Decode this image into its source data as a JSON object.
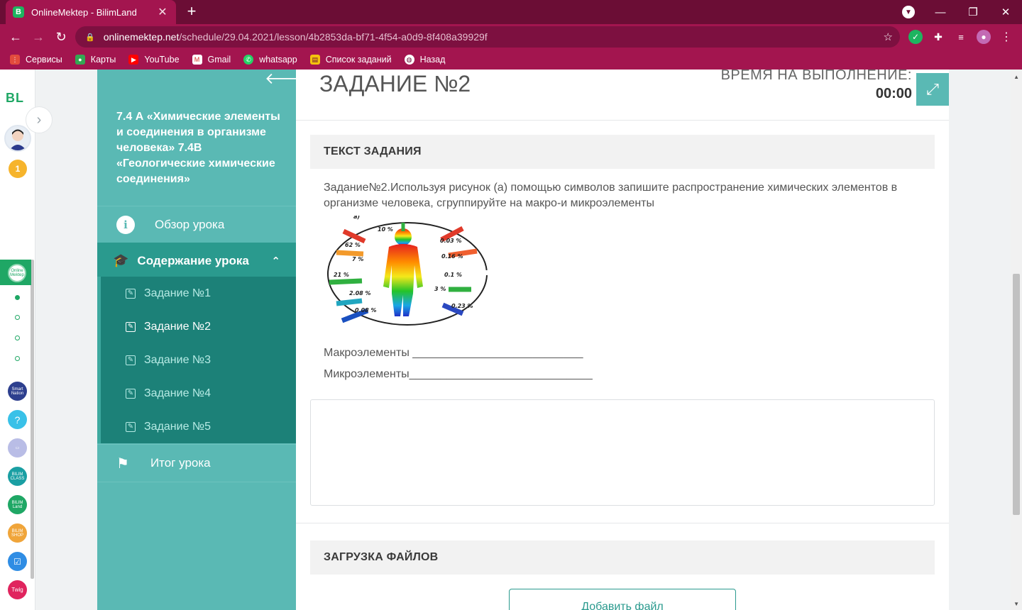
{
  "browser": {
    "tab_title": "OnlineMektep - BilimLand",
    "tab_favicon": "B",
    "url_host": "onlinemektep.net",
    "url_path": "/schedule/29.04.2021/lesson/4b2853da-bf71-4f54-a0d9-8f408a39929f",
    "bookmarks": [
      "Сервисы",
      "Карты",
      "YouTube",
      "Gmail",
      "whatsapp",
      "Список заданий",
      "Назад"
    ]
  },
  "iconbar": {
    "logo": "BL",
    "badge": "1",
    "online_label": "Online Mektep",
    "apps": [
      "Smart Nation",
      "?",
      "",
      "BILIM CLASS",
      "BILIM Land",
      "BILIM SHOP",
      "",
      "Twig"
    ]
  },
  "course": {
    "title": "7.4 А «Химические элементы и соединения в организме человека» 7.4В «Геологические химические соединения»",
    "overview": "Обзор урока",
    "content": "Содержание урока",
    "tasks": [
      "Задание №1",
      "Задание №2",
      "Задание №3",
      "Задание №4",
      "Задание №5"
    ],
    "summary": "Итог урока"
  },
  "task": {
    "title": "ЗАДАНИЕ №2",
    "time_label": "ВРЕМЯ НА ВЫПОЛНЕНИЕ:",
    "time_value": "00:00",
    "text_header": "ТЕКСТ ЗАДАНИЯ",
    "text": "Задание№2.Используя рисунок (а) помощью символов запишите распространение химических элементов в организме человека, сгруппируйте на макро-и микроэлементы",
    "figure_labels": [
      "а)",
      "10 %",
      "62 %",
      "0.03 %",
      "7 %",
      "0.16 %",
      "21 %",
      "0.1 %",
      "2.08 %",
      "3 %",
      "0.08 %",
      "0.23 %"
    ],
    "macro": "Макроэлементы ___________________________",
    "micro": "Микроэлементы_____________________________",
    "answer_value": "",
    "upload_header": "ЗАГРУЗКА ФАЙЛОВ",
    "add_file": "Добавить файл"
  },
  "colors": {
    "chrome_dark": "#6b0d35",
    "chrome": "#a3154f",
    "teal": "#5ab9b4",
    "teal_dark": "#1c8178",
    "green": "#1fa765"
  }
}
